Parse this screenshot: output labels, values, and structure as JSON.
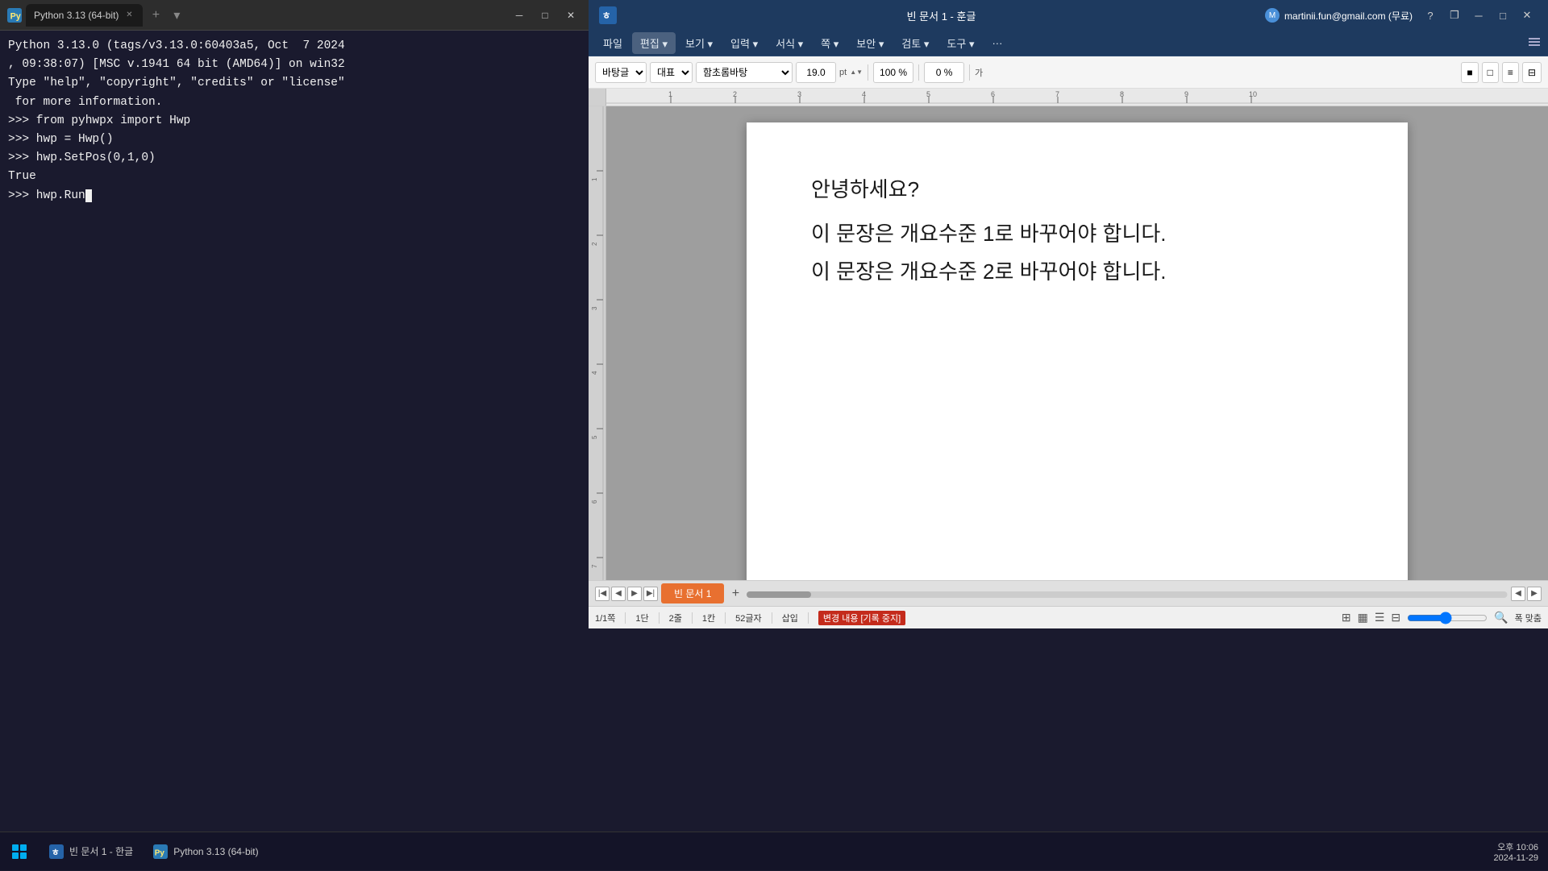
{
  "terminal": {
    "title": "Python 3.13 (64-bit)",
    "tab_label": "Python 3.13 (64-bit)",
    "lines": [
      "Python 3.13.0 (tags/v3.13.0:60403a5, Oct  7 2024",
      ", 09:38:07) [MSC v.1941 64 bit (AMD64)] on win32",
      "Type \"help\", \"copyright\", \"credits\" or \"license\"",
      " for more information.",
      ">>> from pyhwpx import Hwp",
      ">>> hwp = Hwp()",
      ">>> hwp.SetPos(0,1,0)",
      "True",
      ">>> hwp.Run"
    ],
    "prompt_line": ">>> hwp.Run",
    "buttons": {
      "minimize": "─",
      "maximize": "□",
      "close": "✕"
    }
  },
  "hwp": {
    "title": "빈 문서 1 - 훈글",
    "account": "martinii.fun@gmail.com (무료)",
    "menu": [
      "파일",
      "편집",
      "보기",
      "입력",
      "서식",
      "쪽",
      "보안",
      "검토",
      "도구",
      "···"
    ],
    "toolbar": {
      "font_name": "바탕글",
      "font_style": "대표",
      "font_special": "함초롬바탕",
      "font_size": "19.0",
      "font_unit": "pt",
      "zoom": "100 %",
      "rotate": "0 %",
      "resize_label": "가"
    },
    "document": {
      "lines": [
        "안녕하세요?",
        "이  문장은  개요수준  1로  바꾸어야  합니다.",
        "이  문장은  개요수준  2로  바꾸어야  합니다."
      ]
    },
    "sheet_tab": "빈 문서 1",
    "statusbar": {
      "page": "1/1쪽",
      "col": "1단",
      "row": "2줄",
      "char_col": "1칸",
      "char_count": "52글자",
      "insert_mode": "삽입",
      "change_record": "변경 내용 [기록 중지]",
      "datetime": "2024-11-29",
      "time": "오후 10:06"
    },
    "buttons": {
      "minimize": "─",
      "maximize": "□",
      "restore": "❐",
      "close": "✕",
      "help": "?"
    }
  },
  "taskbar": {
    "items": [
      {
        "label": "빈 문서 1 - 한글",
        "icon": "hwp"
      },
      {
        "label": "Python 3.13 (64-bit)",
        "icon": "terminal"
      }
    ],
    "time": "오후 10:06",
    "date": "2024-11-29"
  }
}
